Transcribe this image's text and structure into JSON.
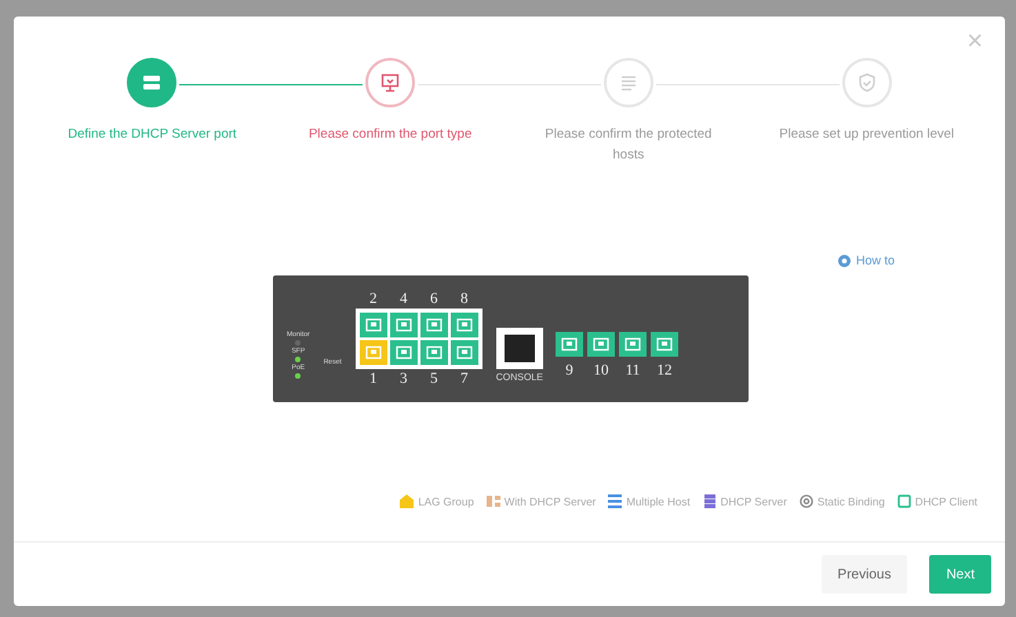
{
  "steps": [
    {
      "label": "Define the DHCP Server port",
      "completed": true,
      "selected": false
    },
    {
      "label": "Please confirm the port type",
      "completed": false,
      "selected": true
    },
    {
      "label": "Please confirm the protected hosts",
      "completed": false,
      "selected": false
    },
    {
      "label": "Please set up prevention level",
      "completed": false,
      "selected": false
    }
  ],
  "close": "×",
  "how_to": "How to",
  "switch": {
    "leds": [
      {
        "label": "Monitor",
        "on": false
      },
      {
        "label": "SFP",
        "on": true
      },
      {
        "label": "PoE",
        "on": true
      }
    ],
    "reset": "Reset",
    "ports_top": [
      {
        "number": "2",
        "kind": "client"
      },
      {
        "number": "4",
        "kind": "client"
      },
      {
        "number": "6",
        "kind": "client"
      },
      {
        "number": "8",
        "kind": "client"
      }
    ],
    "ports_bottom": [
      {
        "number": "1",
        "kind": "lag"
      },
      {
        "number": "3",
        "kind": "client"
      },
      {
        "number": "5",
        "kind": "client"
      },
      {
        "number": "7",
        "kind": "client"
      }
    ],
    "console": "CONSOLE",
    "sfp_ports": [
      {
        "number": "9",
        "kind": "client"
      },
      {
        "number": "10",
        "kind": "client"
      },
      {
        "number": "11",
        "kind": "client"
      },
      {
        "number": "12",
        "kind": "client"
      }
    ]
  },
  "legend": [
    {
      "kind": "lag",
      "label": "LAG Group",
      "color": "#f5c518"
    },
    {
      "kind": "with-server",
      "label": "With DHCP Server",
      "color": "#e8b48a"
    },
    {
      "kind": "multi",
      "label": "Multiple Host",
      "color": "#4a90e2"
    },
    {
      "kind": "server",
      "label": "DHCP Server",
      "color": "#7b6fd6"
    },
    {
      "kind": "static",
      "label": "Static Binding",
      "color": "#8a8a8a"
    },
    {
      "kind": "client",
      "label": "DHCP Client",
      "color": "#2bbf8e"
    }
  ],
  "buttons": [
    {
      "label": "Previous",
      "primary": false
    },
    {
      "label": "Next",
      "primary": true
    }
  ]
}
